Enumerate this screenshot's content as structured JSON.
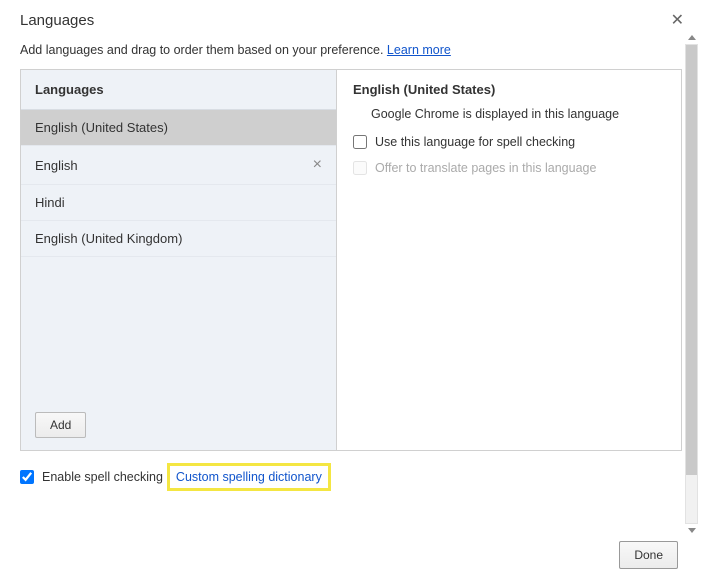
{
  "header": {
    "title": "Languages"
  },
  "subtext": {
    "text": "Add languages and drag to order them based on your preference. ",
    "learn_more": "Learn more"
  },
  "left": {
    "title": "Languages",
    "items": [
      {
        "label": "English (United States)",
        "selected": true,
        "removable": false
      },
      {
        "label": "English",
        "selected": false,
        "removable": true
      },
      {
        "label": "Hindi",
        "selected": false,
        "removable": false
      },
      {
        "label": "English (United Kingdom)",
        "selected": false,
        "removable": false
      }
    ],
    "add_label": "Add"
  },
  "right": {
    "title": "English (United States)",
    "display_text": "Google Chrome is displayed in this language",
    "spellcheck_label": "Use this language for spell checking",
    "translate_label": "Offer to translate pages in this language"
  },
  "bottom": {
    "enable_label": "Enable spell checking",
    "custom_dict": "Custom spelling dictionary"
  },
  "done_label": "Done"
}
